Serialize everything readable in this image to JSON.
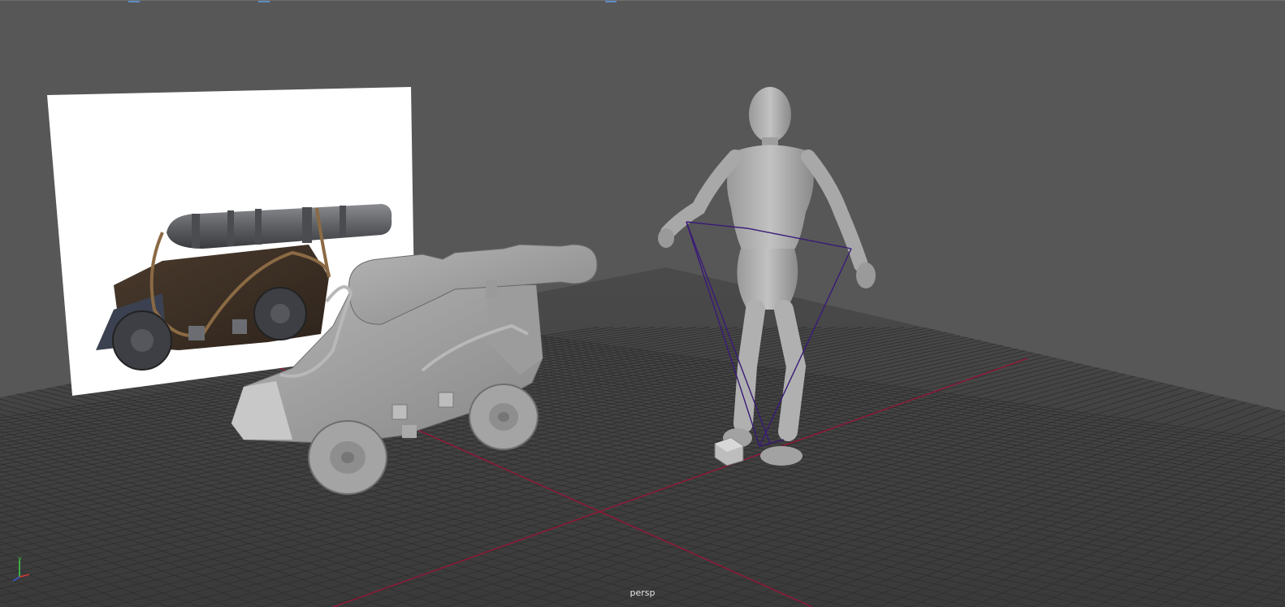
{
  "viewport": {
    "camera_label": "persp",
    "background": "#575757",
    "grid_color": "#2e2e2e",
    "grid_floor": "#454545",
    "origin_axis_color": "#8a1a38",
    "rig_line_color": "#3a1a78"
  },
  "axis_indicator": {
    "y_label": "y",
    "y_color": "#3fd24a",
    "x_color": "#d33a3a",
    "z_color": "#3a5ad3"
  },
  "scene_objects": [
    {
      "id": "reference-image-plane",
      "kind": "image-plane"
    },
    {
      "id": "cannon-model",
      "kind": "mesh"
    },
    {
      "id": "mannequin-character",
      "kind": "mesh"
    },
    {
      "id": "rig-control-cube",
      "kind": "control"
    }
  ]
}
